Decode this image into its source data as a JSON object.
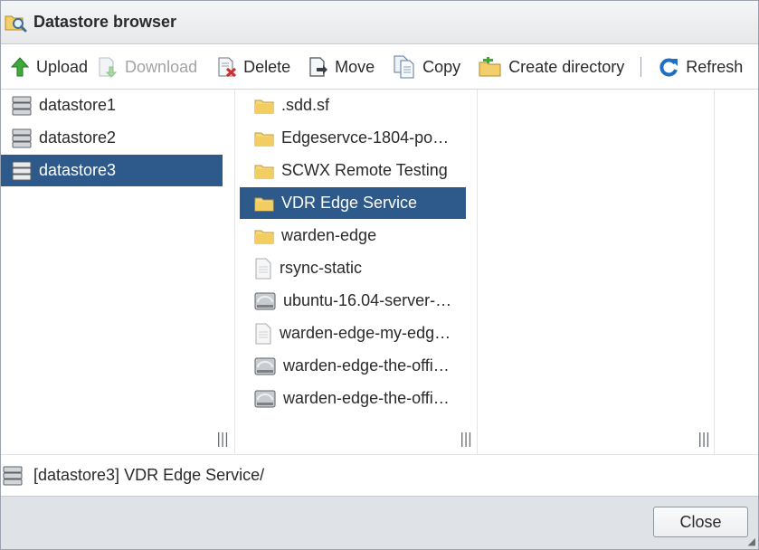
{
  "window": {
    "title": "Datastore browser"
  },
  "toolbar": {
    "upload": "Upload",
    "download": "Download",
    "delete": "Delete",
    "move": "Move",
    "copy": "Copy",
    "create_directory": "Create directory",
    "refresh": "Refresh"
  },
  "datastores": [
    {
      "name": "datastore1",
      "icon": "datastore-icon",
      "selected": false
    },
    {
      "name": "datastore2",
      "icon": "datastore-icon",
      "selected": false
    },
    {
      "name": "datastore3",
      "icon": "datastore-icon",
      "selected": true
    }
  ],
  "files": [
    {
      "name": ".sdd.sf",
      "icon": "folder-icon",
      "selected": false
    },
    {
      "name": "Edgeservce-1804-po…",
      "icon": "folder-icon",
      "selected": false
    },
    {
      "name": "SCWX Remote Testing",
      "icon": "folder-icon",
      "selected": false
    },
    {
      "name": "VDR Edge Service",
      "icon": "folder-icon",
      "selected": true
    },
    {
      "name": "warden-edge",
      "icon": "folder-icon",
      "selected": false
    },
    {
      "name": "rsync-static",
      "icon": "file-icon",
      "selected": false
    },
    {
      "name": "ubuntu-16.04-server-…",
      "icon": "disk-icon",
      "selected": false
    },
    {
      "name": "warden-edge-my-edg…",
      "icon": "file-icon",
      "selected": false
    },
    {
      "name": "warden-edge-the-offi…",
      "icon": "disk-icon",
      "selected": false
    },
    {
      "name": "warden-edge-the-offi…",
      "icon": "disk-icon",
      "selected": false
    }
  ],
  "path": {
    "text": "[datastore3] VDR Edge Service/"
  },
  "footer": {
    "close": "Close"
  },
  "colors": {
    "selection": "#2d5a8a",
    "footer_bg": "#dfe3e8",
    "accent_blue": "#1f6fc4"
  }
}
